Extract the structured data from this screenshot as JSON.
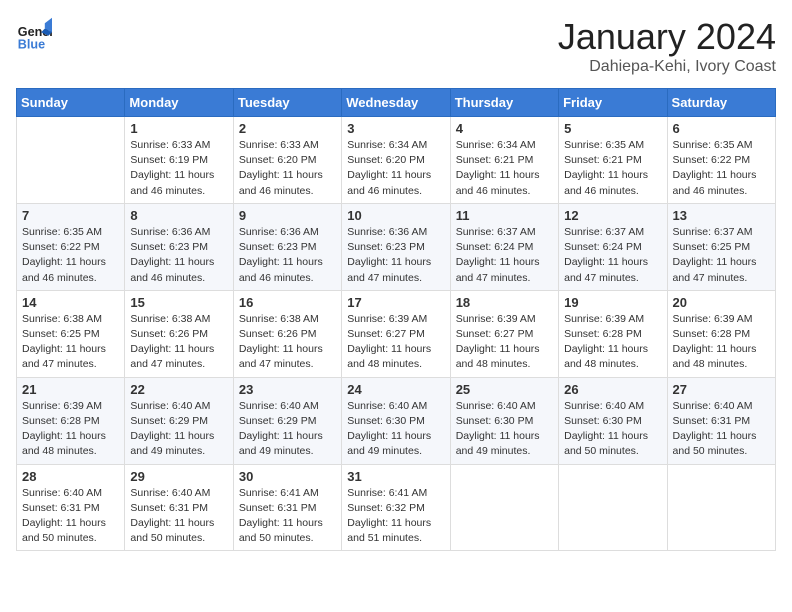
{
  "header": {
    "logo_line1": "General",
    "logo_line2": "Blue",
    "month": "January 2024",
    "location": "Dahiepa-Kehi, Ivory Coast"
  },
  "weekdays": [
    "Sunday",
    "Monday",
    "Tuesday",
    "Wednesday",
    "Thursday",
    "Friday",
    "Saturday"
  ],
  "weeks": [
    [
      {
        "day": "",
        "sunrise": "",
        "sunset": "",
        "daylight": ""
      },
      {
        "day": "1",
        "sunrise": "6:33 AM",
        "sunset": "6:19 PM",
        "daylight": "11 hours and 46 minutes."
      },
      {
        "day": "2",
        "sunrise": "6:33 AM",
        "sunset": "6:20 PM",
        "daylight": "11 hours and 46 minutes."
      },
      {
        "day": "3",
        "sunrise": "6:34 AM",
        "sunset": "6:20 PM",
        "daylight": "11 hours and 46 minutes."
      },
      {
        "day": "4",
        "sunrise": "6:34 AM",
        "sunset": "6:21 PM",
        "daylight": "11 hours and 46 minutes."
      },
      {
        "day": "5",
        "sunrise": "6:35 AM",
        "sunset": "6:21 PM",
        "daylight": "11 hours and 46 minutes."
      },
      {
        "day": "6",
        "sunrise": "6:35 AM",
        "sunset": "6:22 PM",
        "daylight": "11 hours and 46 minutes."
      }
    ],
    [
      {
        "day": "7",
        "sunrise": "6:35 AM",
        "sunset": "6:22 PM",
        "daylight": "11 hours and 46 minutes."
      },
      {
        "day": "8",
        "sunrise": "6:36 AM",
        "sunset": "6:23 PM",
        "daylight": "11 hours and 46 minutes."
      },
      {
        "day": "9",
        "sunrise": "6:36 AM",
        "sunset": "6:23 PM",
        "daylight": "11 hours and 46 minutes."
      },
      {
        "day": "10",
        "sunrise": "6:36 AM",
        "sunset": "6:23 PM",
        "daylight": "11 hours and 47 minutes."
      },
      {
        "day": "11",
        "sunrise": "6:37 AM",
        "sunset": "6:24 PM",
        "daylight": "11 hours and 47 minutes."
      },
      {
        "day": "12",
        "sunrise": "6:37 AM",
        "sunset": "6:24 PM",
        "daylight": "11 hours and 47 minutes."
      },
      {
        "day": "13",
        "sunrise": "6:37 AM",
        "sunset": "6:25 PM",
        "daylight": "11 hours and 47 minutes."
      }
    ],
    [
      {
        "day": "14",
        "sunrise": "6:38 AM",
        "sunset": "6:25 PM",
        "daylight": "11 hours and 47 minutes."
      },
      {
        "day": "15",
        "sunrise": "6:38 AM",
        "sunset": "6:26 PM",
        "daylight": "11 hours and 47 minutes."
      },
      {
        "day": "16",
        "sunrise": "6:38 AM",
        "sunset": "6:26 PM",
        "daylight": "11 hours and 47 minutes."
      },
      {
        "day": "17",
        "sunrise": "6:39 AM",
        "sunset": "6:27 PM",
        "daylight": "11 hours and 48 minutes."
      },
      {
        "day": "18",
        "sunrise": "6:39 AM",
        "sunset": "6:27 PM",
        "daylight": "11 hours and 48 minutes."
      },
      {
        "day": "19",
        "sunrise": "6:39 AM",
        "sunset": "6:28 PM",
        "daylight": "11 hours and 48 minutes."
      },
      {
        "day": "20",
        "sunrise": "6:39 AM",
        "sunset": "6:28 PM",
        "daylight": "11 hours and 48 minutes."
      }
    ],
    [
      {
        "day": "21",
        "sunrise": "6:39 AM",
        "sunset": "6:28 PM",
        "daylight": "11 hours and 48 minutes."
      },
      {
        "day": "22",
        "sunrise": "6:40 AM",
        "sunset": "6:29 PM",
        "daylight": "11 hours and 49 minutes."
      },
      {
        "day": "23",
        "sunrise": "6:40 AM",
        "sunset": "6:29 PM",
        "daylight": "11 hours and 49 minutes."
      },
      {
        "day": "24",
        "sunrise": "6:40 AM",
        "sunset": "6:30 PM",
        "daylight": "11 hours and 49 minutes."
      },
      {
        "day": "25",
        "sunrise": "6:40 AM",
        "sunset": "6:30 PM",
        "daylight": "11 hours and 49 minutes."
      },
      {
        "day": "26",
        "sunrise": "6:40 AM",
        "sunset": "6:30 PM",
        "daylight": "11 hours and 50 minutes."
      },
      {
        "day": "27",
        "sunrise": "6:40 AM",
        "sunset": "6:31 PM",
        "daylight": "11 hours and 50 minutes."
      }
    ],
    [
      {
        "day": "28",
        "sunrise": "6:40 AM",
        "sunset": "6:31 PM",
        "daylight": "11 hours and 50 minutes."
      },
      {
        "day": "29",
        "sunrise": "6:40 AM",
        "sunset": "6:31 PM",
        "daylight": "11 hours and 50 minutes."
      },
      {
        "day": "30",
        "sunrise": "6:41 AM",
        "sunset": "6:31 PM",
        "daylight": "11 hours and 50 minutes."
      },
      {
        "day": "31",
        "sunrise": "6:41 AM",
        "sunset": "6:32 PM",
        "daylight": "11 hours and 51 minutes."
      },
      {
        "day": "",
        "sunrise": "",
        "sunset": "",
        "daylight": ""
      },
      {
        "day": "",
        "sunrise": "",
        "sunset": "",
        "daylight": ""
      },
      {
        "day": "",
        "sunrise": "",
        "sunset": "",
        "daylight": ""
      }
    ]
  ]
}
